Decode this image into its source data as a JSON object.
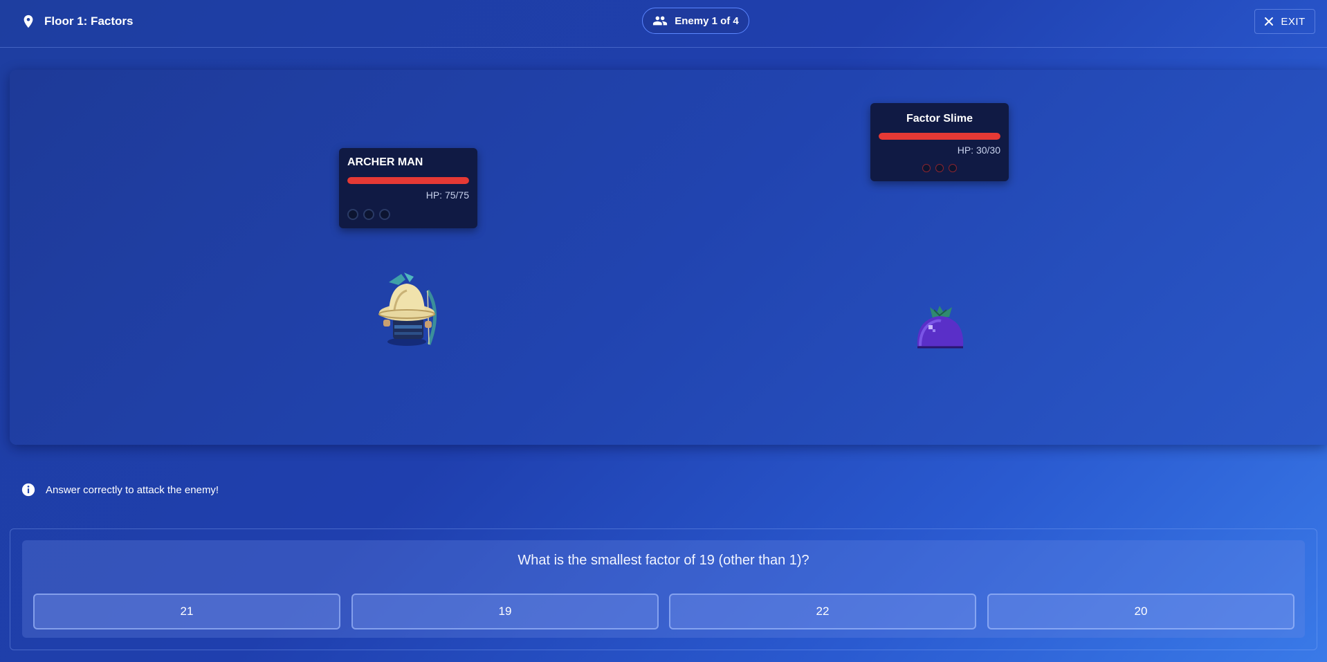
{
  "header": {
    "floor_label": "Floor 1: Factors",
    "enemy_counter": "Enemy 1 of 4",
    "exit_label": "EXIT"
  },
  "player": {
    "name": "ARCHER MAN",
    "hp_text": "HP: 75/75",
    "hp_fraction": 1.0,
    "charge_slots": 3
  },
  "enemy": {
    "name": "Factor Slime",
    "hp_text": "HP: 30/30",
    "hp_fraction": 1.0,
    "charge_slots": 3
  },
  "hint": "Answer correctly to attack the enemy!",
  "question": {
    "text": "What is the smallest factor of 19 (other than 1)?",
    "answers": [
      "21",
      "19",
      "22",
      "20"
    ]
  },
  "colors": {
    "hp_bar": "#e53935",
    "card_bg": "#101a44",
    "pill_border": "#5b86ff"
  }
}
